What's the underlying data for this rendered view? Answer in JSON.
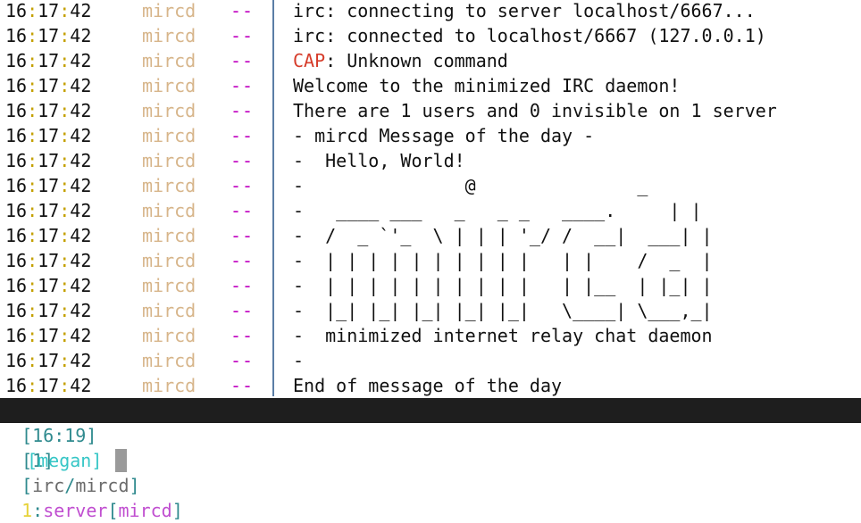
{
  "log": [
    {
      "h": "16",
      "m": "17",
      "s": "42",
      "nick": "mircd",
      "prefix": "--",
      "msg": "irc: connecting to server localhost/6667..."
    },
    {
      "h": "16",
      "m": "17",
      "s": "42",
      "nick": "mircd",
      "prefix": "--",
      "msg": "irc: connected to localhost/6667 (127.0.0.1)"
    },
    {
      "h": "16",
      "m": "17",
      "s": "42",
      "nick": "mircd",
      "prefix": "--",
      "msg_hl": "CAP",
      "msg": ": Unknown command"
    },
    {
      "h": "16",
      "m": "17",
      "s": "42",
      "nick": "mircd",
      "prefix": "--",
      "msg": "Welcome to the minimized IRC daemon!"
    },
    {
      "h": "16",
      "m": "17",
      "s": "42",
      "nick": "mircd",
      "prefix": "--",
      "msg": "There are 1 users and 0 invisible on 1 server"
    },
    {
      "h": "16",
      "m": "17",
      "s": "42",
      "nick": "mircd",
      "prefix": "--",
      "msg": "- mircd Message of the day -"
    },
    {
      "h": "16",
      "m": "17",
      "s": "42",
      "nick": "mircd",
      "prefix": "--",
      "msg": "-  Hello, World!"
    },
    {
      "h": "16",
      "m": "17",
      "s": "42",
      "nick": "mircd",
      "prefix": "--",
      "msg": "-               @               _"
    },
    {
      "h": "16",
      "m": "17",
      "s": "42",
      "nick": "mircd",
      "prefix": "--",
      "msg": "-   ____ ___   _   _ _   ____.     | |"
    },
    {
      "h": "16",
      "m": "17",
      "s": "42",
      "nick": "mircd",
      "prefix": "--",
      "msg": "-  /  _ `'_  \\ | | | '_/ /  __|  ___| |"
    },
    {
      "h": "16",
      "m": "17",
      "s": "42",
      "nick": "mircd",
      "prefix": "--",
      "msg": "-  | | | | | | | | | |   | |    /  _  |"
    },
    {
      "h": "16",
      "m": "17",
      "s": "42",
      "nick": "mircd",
      "prefix": "--",
      "msg": "-  | | | | | | | | | |   | |__  | |_| |"
    },
    {
      "h": "16",
      "m": "17",
      "s": "42",
      "nick": "mircd",
      "prefix": "--",
      "msg": "-  |_| |_| |_| |_| |_|   \\____| \\___,_|"
    },
    {
      "h": "16",
      "m": "17",
      "s": "42",
      "nick": "mircd",
      "prefix": "--",
      "msg": "-  minimized internet relay chat daemon"
    },
    {
      "h": "16",
      "m": "17",
      "s": "42",
      "nick": "mircd",
      "prefix": "--",
      "msg": "-"
    },
    {
      "h": "16",
      "m": "17",
      "s": "42",
      "nick": "mircd",
      "prefix": "--",
      "msg": "End of message of the day"
    }
  ],
  "statusbar": {
    "time": "[16:19]",
    "window_num": "[1]",
    "net_open": "[",
    "net_irc": "irc",
    "net_slash": "/",
    "net_server": "mircd",
    "net_close": "]",
    "buffer_num": "1",
    "buffer_colon": ":",
    "buffer_name": "server",
    "buffer_sub_open": "[",
    "buffer_sub": "mircd",
    "buffer_sub_close": "]"
  },
  "input": {
    "nick": "[megan]",
    "value": ""
  },
  "colors": {
    "timestamp_separator": "#c4a000",
    "nick": "#d7b58a",
    "prefix": "#c000c0",
    "error_keyword": "#d63c2a",
    "divider": "#5b7ea6",
    "statusbar_bg": "#1e1e1e",
    "input_nick": "#36c6c6"
  }
}
